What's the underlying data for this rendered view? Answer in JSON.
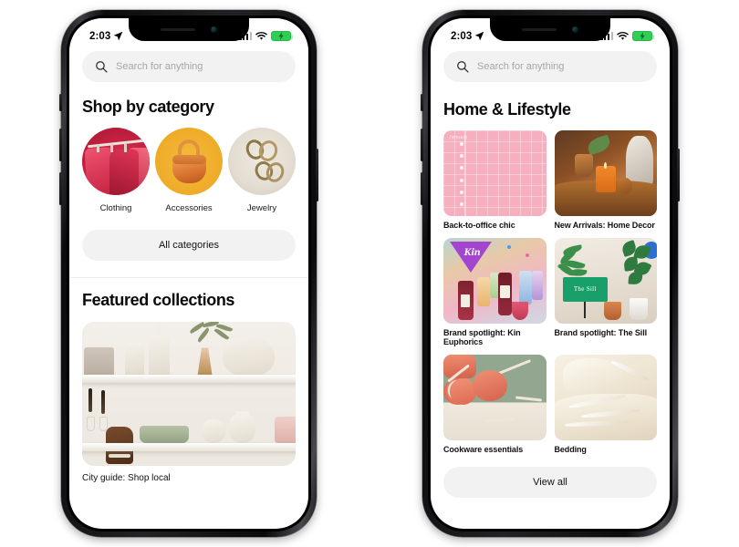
{
  "statusbar": {
    "time": "2:03",
    "location_icon": "location-arrow-icon",
    "signal_icon": "cellular-bars-icon",
    "wifi_icon": "wifi-icon",
    "battery_icon": "battery-charging-icon"
  },
  "search": {
    "placeholder": "Search for anything",
    "icon": "search-icon"
  },
  "left_phone": {
    "category_section": {
      "title": "Shop by category",
      "categories": [
        {
          "label": "Clothing",
          "image": "red-clothing-rack"
        },
        {
          "label": "Accessories",
          "image": "orange-handbag"
        },
        {
          "label": "Jewelry",
          "image": "gold-rings"
        }
      ],
      "all_button": "All categories"
    },
    "featured_section": {
      "title": "Featured collections",
      "cards": [
        {
          "caption": "City guide: Shop local",
          "image": "white-shelf-ceramics"
        }
      ]
    }
  },
  "right_phone": {
    "title": "Home & Lifestyle",
    "tiles": [
      {
        "caption": "Back-to-office chic",
        "image": "pink-planner-01"
      },
      {
        "caption": "New Arrivals: Home Decor",
        "image": "candle-bust-table"
      },
      {
        "caption": "Brand spotlight: Kin Euphorics",
        "image": "kin-bottles-party",
        "logo_text": "Kin"
      },
      {
        "caption": "Brand spotlight: The Sill",
        "image": "houseplants-sign",
        "sign_text": "The Sill"
      },
      {
        "caption": "Cookware essentials",
        "image": "coral-cookware-set"
      },
      {
        "caption": "Bedding",
        "image": "cream-bedding"
      }
    ],
    "view_all_button": "View all"
  },
  "colors": {
    "clothing": "#c32040",
    "accessories": "#eeab28",
    "jewelry": "#e2dcd1",
    "planner_pink": "#f6afbe",
    "kin_purple": "#a445cf",
    "sill_green": "#19a06a",
    "cookware_coral": "#dd6b52",
    "battery_green": "#2fcf55",
    "chip_gray": "#f2f2f2"
  }
}
